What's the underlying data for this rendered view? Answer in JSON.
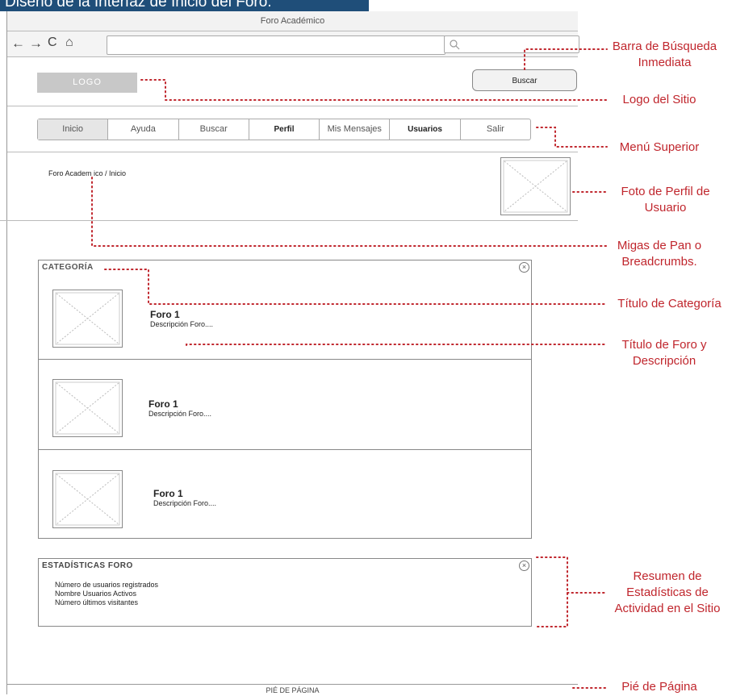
{
  "caption": "Diseño de la Interfaz de Inicio del Foro.",
  "browser": {
    "window_title": "Foro Académico",
    "url_value": "",
    "search_value": ""
  },
  "header": {
    "logo_label": "LOGO",
    "search_button": "Buscar"
  },
  "menu": {
    "items": [
      {
        "label": "Inicio"
      },
      {
        "label": "Ayuda"
      },
      {
        "label": "Buscar"
      },
      {
        "label": "Perfil"
      },
      {
        "label": "Mis Mensajes"
      },
      {
        "label": "Usuarios"
      },
      {
        "label": "Salir"
      }
    ]
  },
  "breadcrumb": "Foro Academ ico / Inicio",
  "category_panel": {
    "title": "CATEGORÍA",
    "forums": [
      {
        "title": "Foro 1",
        "description": "Descripción Foro...."
      },
      {
        "title": "Foro 1",
        "description": "Descripción Foro...."
      },
      {
        "title": "Foro 1",
        "description": "Descripción Foro...."
      }
    ]
  },
  "stats_panel": {
    "title": "ESTADÍSTICAS FORO",
    "lines": [
      "Número de usuarios registrados",
      "Nombre Usuarios Activos",
      "Número últimos visitantes"
    ]
  },
  "footer": "PIÉ DE PÁGINA",
  "annotations": {
    "search_bar_1": "Barra de Búsqueda",
    "search_bar_2": "Inmediata",
    "logo": "Logo del Sitio",
    "menu": "Menú Superior",
    "profile_1": "Foto de Perfil de",
    "profile_2": "Usuario",
    "breadcrumbs_1": "Migas de Pan o",
    "breadcrumbs_2": "Breadcrumbs.",
    "category_title": "Título de Categoría",
    "forum_title_1": "Título de Foro y",
    "forum_title_2": "Descripción",
    "stats_1": "Resumen de",
    "stats_2": "Estadísticas de",
    "stats_3": "Actividad en el Sitio",
    "footer": "Pié de Página"
  },
  "colors": {
    "annotation": "#c0262d",
    "caption_bg": "#1f4e79"
  },
  "icons": [
    "back-icon",
    "forward-icon",
    "reload-icon",
    "home-icon",
    "search-icon",
    "close-icon",
    "image-placeholder-icon"
  ]
}
